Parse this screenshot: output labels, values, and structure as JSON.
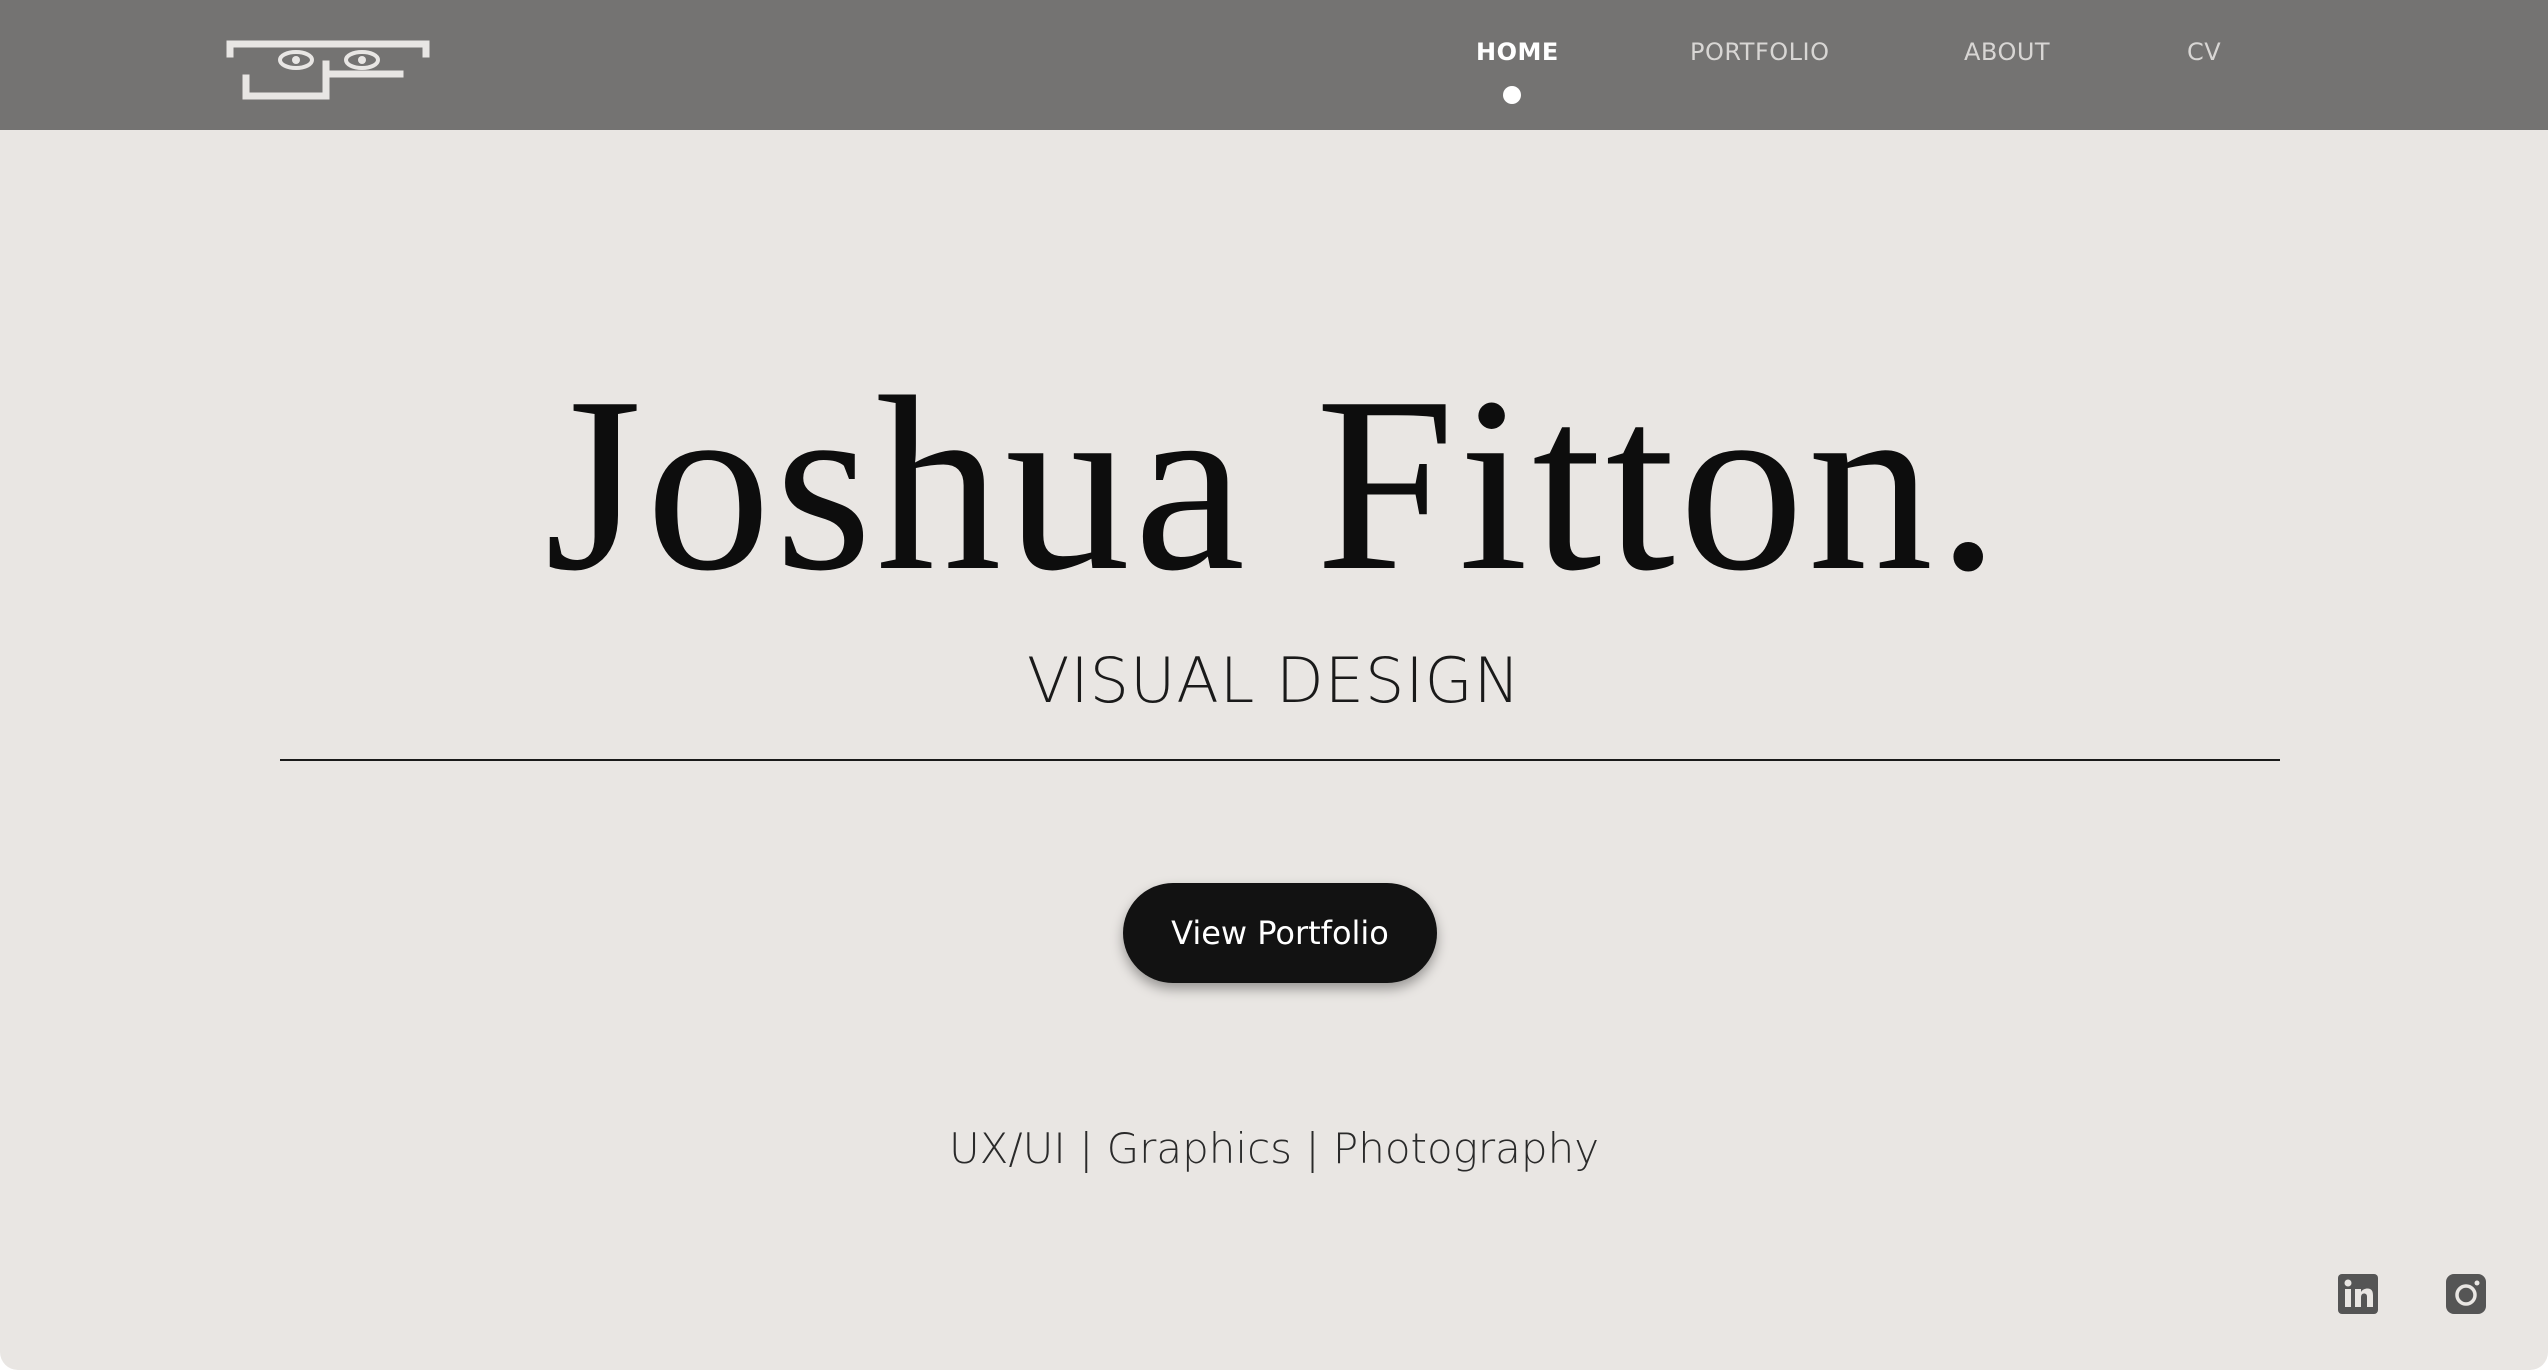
{
  "colors": {
    "header_bg": "#747372",
    "page_bg": "#e9e6e3",
    "nav_text": "#d8d6d4",
    "nav_active": "#ffffff",
    "button_bg": "#121212",
    "text_dark": "#0d0d0d"
  },
  "header": {
    "logo_icon": "monogram-logo-icon",
    "nav": [
      {
        "label": "HOME",
        "active": true
      },
      {
        "label": "PORTFOLIO",
        "active": false
      },
      {
        "label": "ABOUT",
        "active": false
      },
      {
        "label": "CV",
        "active": false
      }
    ]
  },
  "hero": {
    "name": "Joshua Fitton.",
    "subtitle": "VISUAL DESIGN",
    "button_label": "View Portfolio",
    "tagline": "UX/UI | Graphics | Photography"
  },
  "social": {
    "icons": [
      "linkedin-icon",
      "instagram-icon"
    ]
  }
}
